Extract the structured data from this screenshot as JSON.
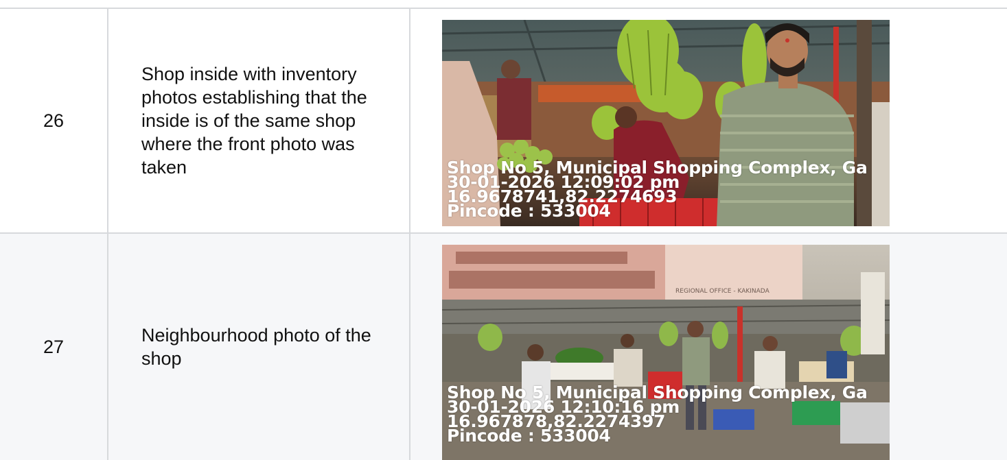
{
  "rows": [
    {
      "number": "26",
      "description": "Shop inside with inventory photos establishing that the inside is of the same shop where the front photo was taken",
      "photo": {
        "scene": "fruit-market-stall-interior",
        "stamp": [
          "Shop No 5, Municipal Shopping Complex, Ga",
          "30-01-2026 12:09:02 pm",
          "16.9678741,82.2274693",
          "Pincode : 533004"
        ]
      }
    },
    {
      "number": "27",
      "description": "Neighbourhood photo of the shop",
      "photo": {
        "scene": "market-neighbourhood-view",
        "banner_text": "REGIONAL OFFICE - KAKINADA",
        "stamp": [
          "Shop No 5, Municipal Shopping Complex, Ga",
          "30-01-2026 12:10:16 pm",
          "16.967878,82.2274397",
          "Pincode : 533004"
        ]
      }
    }
  ],
  "colors": {
    "border": "#d7d9dc",
    "alt_row": "#f6f7f9",
    "stamp_text": "#ffffff"
  }
}
